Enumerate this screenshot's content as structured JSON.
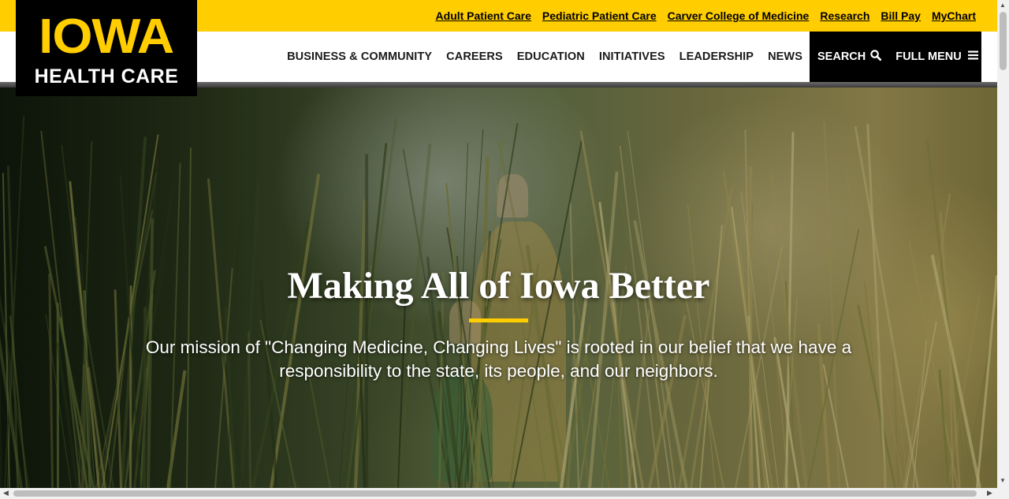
{
  "utility_nav": {
    "links": [
      {
        "label": "Adult Patient Care"
      },
      {
        "label": "Pediatric Patient Care"
      },
      {
        "label": "Carver College of Medicine"
      },
      {
        "label": "Research"
      },
      {
        "label": "Bill Pay"
      },
      {
        "label": "MyChart"
      }
    ]
  },
  "logo": {
    "primary": "IOWA",
    "secondary": "HEALTH CARE"
  },
  "main_nav": {
    "links": [
      {
        "label": "BUSINESS & COMMUNITY"
      },
      {
        "label": "CAREERS"
      },
      {
        "label": "EDUCATION"
      },
      {
        "label": "INITIATIVES"
      },
      {
        "label": "LEADERSHIP"
      },
      {
        "label": "NEWS"
      }
    ],
    "search_label": "SEARCH",
    "search_icon": "search-icon",
    "menu_label": "FULL MENU",
    "menu_icon": "hamburger-icon"
  },
  "hero": {
    "title": "Making All of Iowa Better",
    "text": "Our mission of \"Changing Medicine, Changing Lives\" is rooted in our belief that we have a responsibility to the state, its people, and our neighbors."
  },
  "colors": {
    "brand_gold": "#ffcd00",
    "brand_black": "#000000"
  }
}
